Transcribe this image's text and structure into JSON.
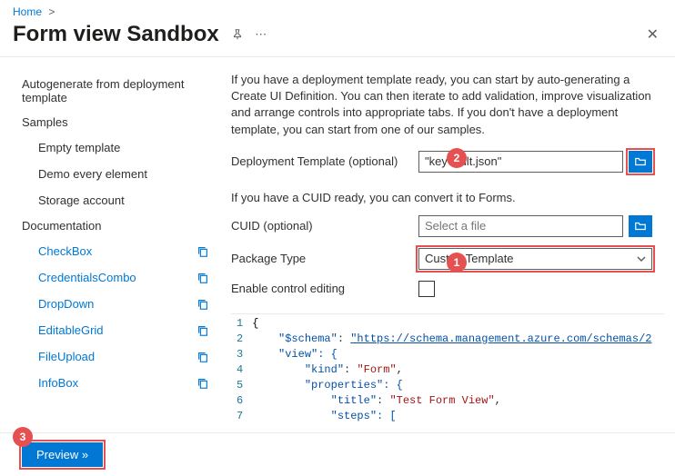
{
  "breadcrumb": {
    "home": "Home"
  },
  "header": {
    "title": "Form view Sandbox"
  },
  "sidebar": {
    "group0": "Autogenerate from deployment template",
    "group1": "Samples",
    "samples": [
      {
        "label": "Empty template"
      },
      {
        "label": "Demo every element"
      },
      {
        "label": "Storage account"
      }
    ],
    "group2": "Documentation",
    "docs": [
      {
        "label": "CheckBox"
      },
      {
        "label": "CredentialsCombo"
      },
      {
        "label": "DropDown"
      },
      {
        "label": "EditableGrid"
      },
      {
        "label": "FileUpload"
      },
      {
        "label": "InfoBox"
      }
    ]
  },
  "main": {
    "intro": "If you have a deployment template ready, you can start by auto-generating a Create UI Definition. You can then iterate to add validation, improve visualization and arrange controls into appropriate tabs. If you don't have a deployment template, you can start from one of our samples.",
    "deploy_label": "Deployment Template (optional)",
    "deploy_value": "\"keyvault.json\"",
    "cuid_hint": "If you have a CUID ready, you can convert it to Forms.",
    "cuid_label": "CUID (optional)",
    "cuid_placeholder": "Select a file",
    "pkg_label": "Package Type",
    "pkg_value": "CustomTemplate",
    "enable_label": "Enable control editing"
  },
  "code": {
    "l1": "{",
    "l2a": "    \"$schema\"",
    "l2b": ": ",
    "l2c": "\"https://schema.management.azure.com/schemas/2",
    "l3": "    \"view\": {",
    "l4a": "        \"kind\"",
    "l4b": ": ",
    "l4c": "\"Form\"",
    "l4d": ",",
    "l5": "        \"properties\": {",
    "l6a": "            \"title\"",
    "l6b": ": ",
    "l6c": "\"Test Form View\"",
    "l6d": ",",
    "l7": "            \"steps\": ["
  },
  "footer": {
    "preview": "Preview »"
  },
  "callouts": {
    "c1": "1",
    "c2": "2",
    "c3": "3"
  }
}
